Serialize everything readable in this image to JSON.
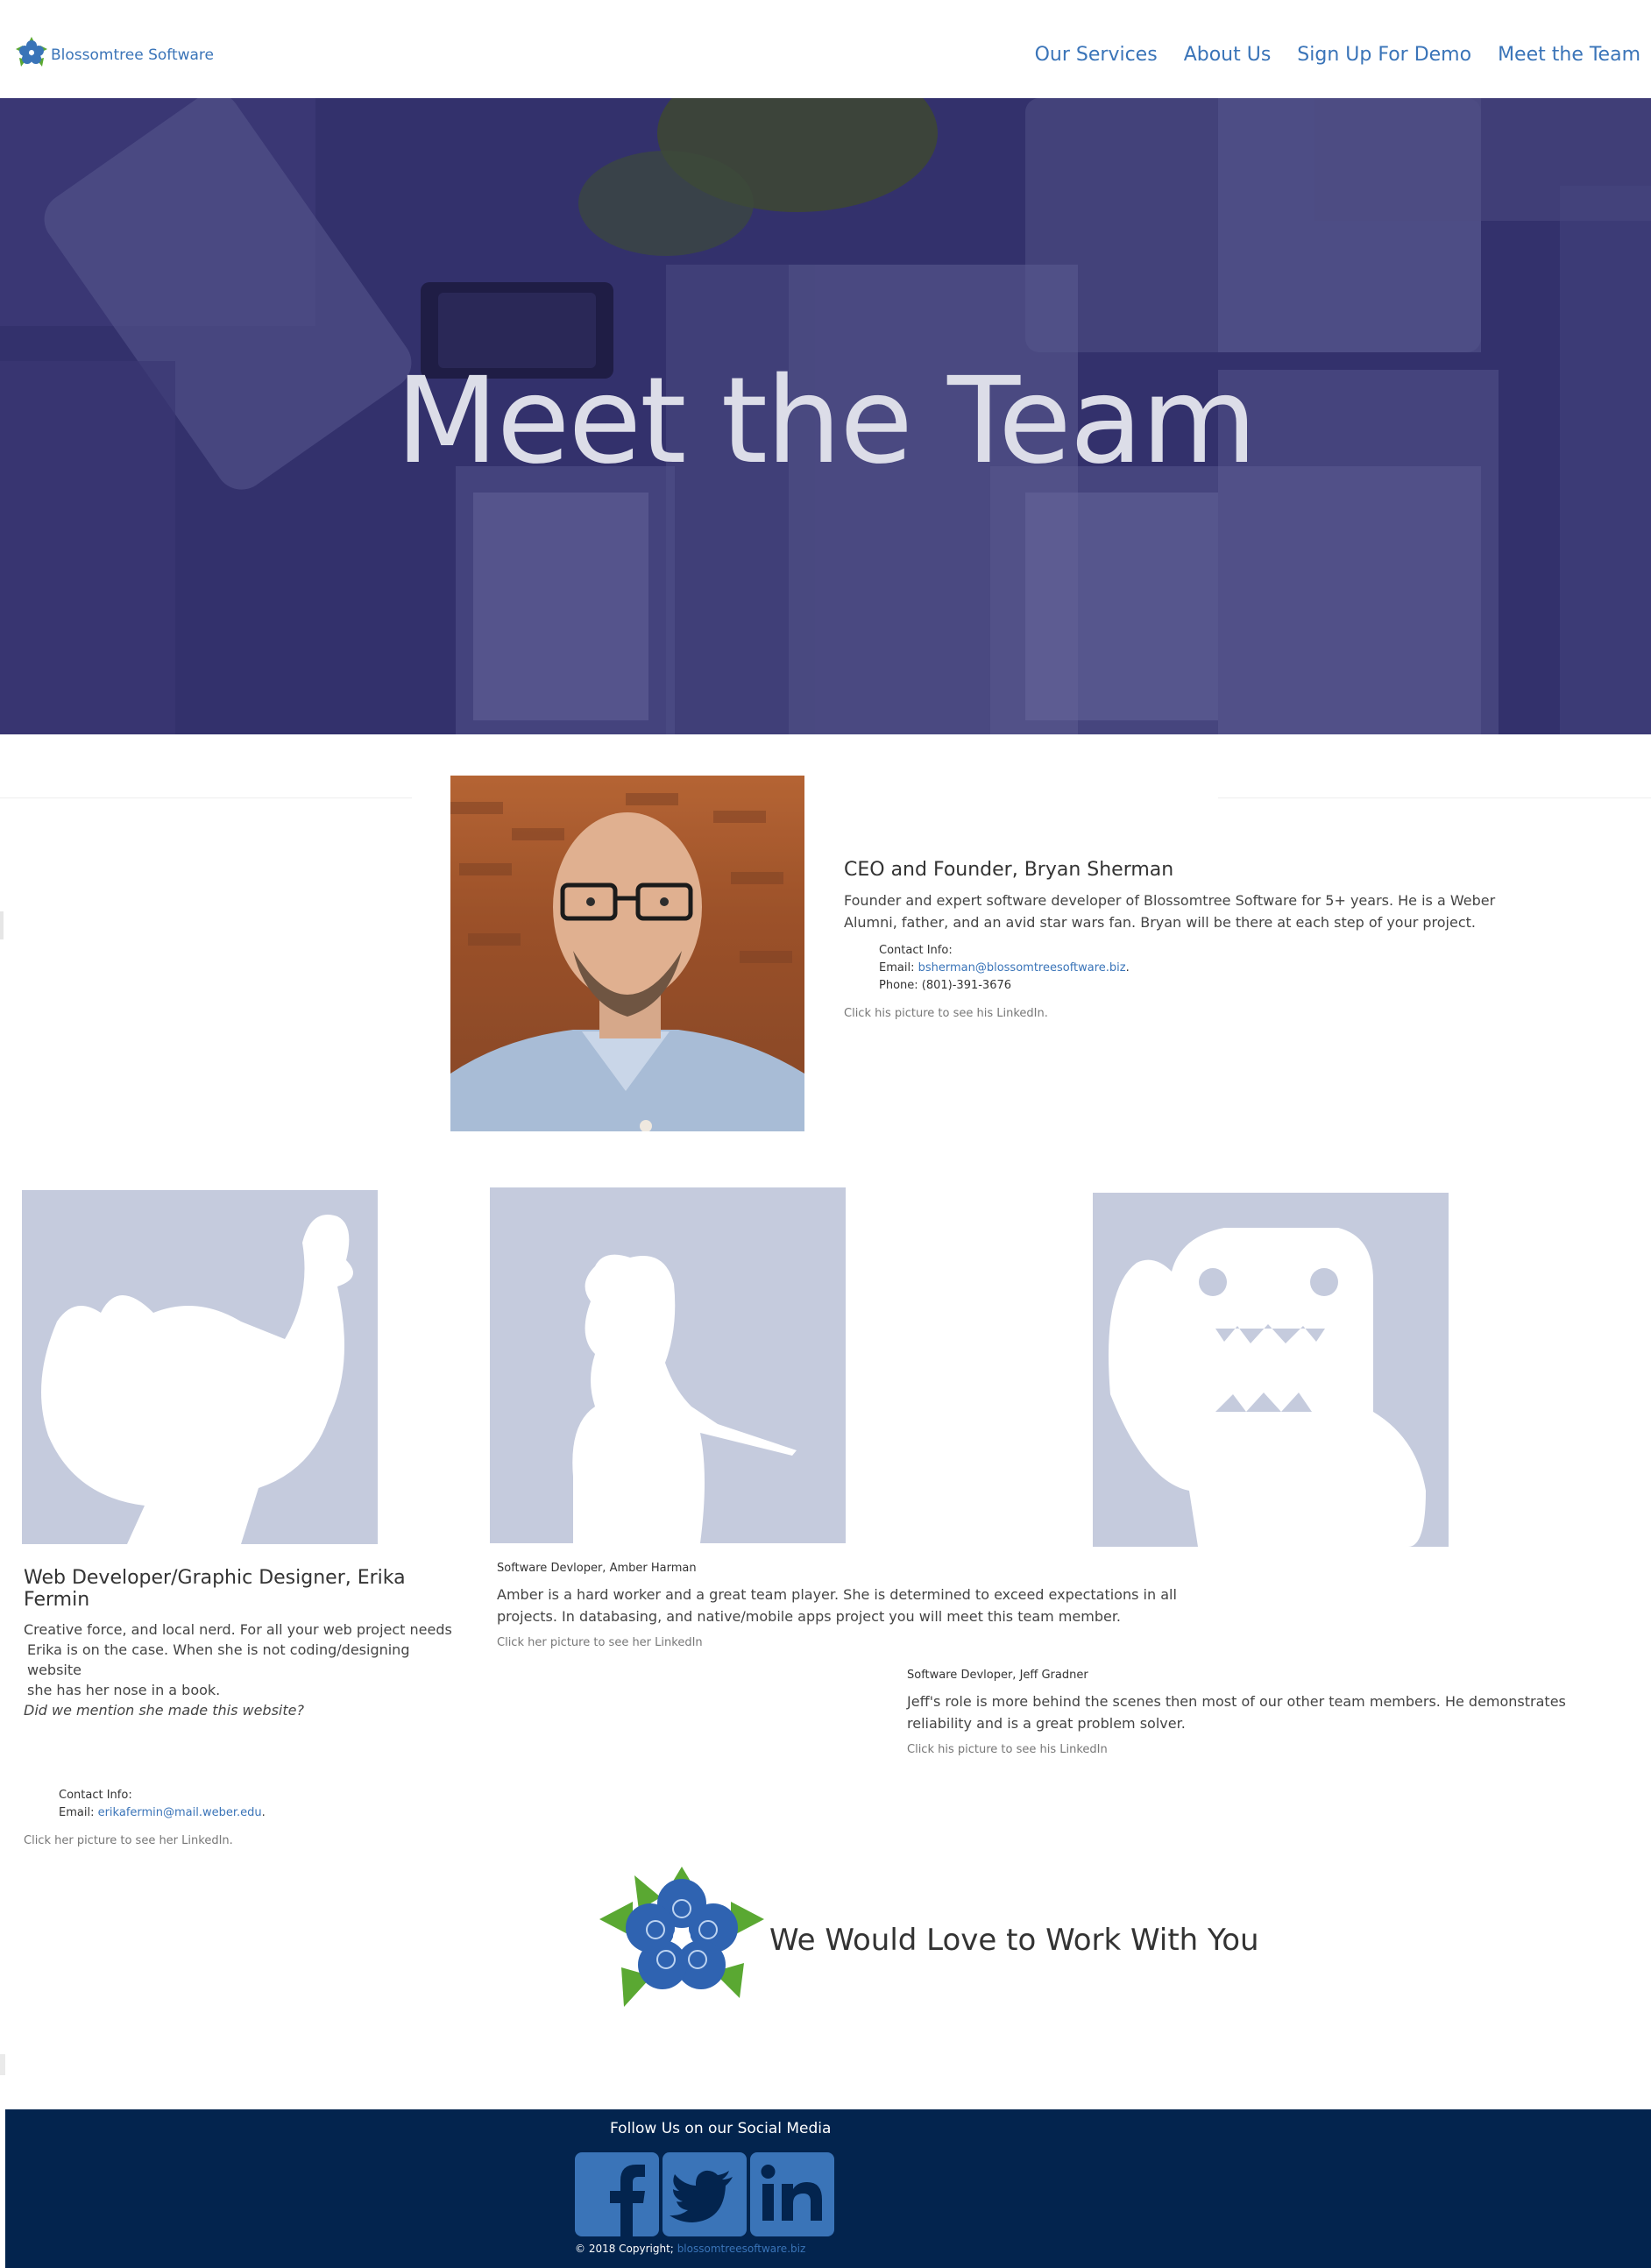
{
  "header": {
    "brand": "Blossomtree Software",
    "nav": [
      "Our Services",
      "About Us",
      "Sign Up For Demo",
      "Meet the Team"
    ]
  },
  "hero": {
    "title": "Meet the Team"
  },
  "ceo": {
    "title": "CEO and Founder, Bryan Sherman",
    "desc": "Founder and expert software developer of Blossomtree Software for 5+ years. He is a Weber Alumni, father, and an avid star wars fan. Bryan will be there at each step of your project.",
    "contact_label": "Contact Info:",
    "email_label": "Email:",
    "email": "bsherman@blossomtreesoftware.biz",
    "phone": "Phone: (801)-391-3676",
    "hint": "Click his picture to see his LinkedIn."
  },
  "erika": {
    "title": "Web Developer/Graphic Designer, Erika Fermin",
    "desc_line1": "Creative force, and local nerd. For all your web project needs",
    "desc_line2": "Erika is on the case. When she is not   coding/designing website",
    "desc_line3": "she has her nose in a book.",
    "desc_italic": "Did we mention she made this website?",
    "contact_label": "Contact Info:",
    "email_label": "Email:",
    "email": "erikafermin@mail.weber.edu",
    "hint": "Click her picture to see her LinkedIn."
  },
  "amber": {
    "title": "Software Devloper, Amber Harman",
    "desc": "Amber is a hard worker and a great team player. She is determined to exceed expectations in all projects. In databasing, and native/mobile apps project you will meet this team member.",
    "hint": "Click her picture to see her LinkedIn"
  },
  "jeff": {
    "title": "Software Devloper, Jeff Gradner",
    "desc": "Jeff's role is more behind the scenes then most of our other team members. He demonstrates reliability and is a great problem solver.",
    "hint": "Click his picture to see his LinkedIn"
  },
  "cta": {
    "text": "We Would Love to Work With You"
  },
  "footer": {
    "follow": "Follow Us on our Social Media",
    "copyright": "© 2018 Copyright;",
    "site": "blossomtreesoftware.biz"
  },
  "colors": {
    "brand_blue": "#3a74b8",
    "footer_navy": "#03244e",
    "hero_overlay": "#2e2c66",
    "silhouette_bg": "#c5cbdd"
  },
  "icons": [
    "blossom-logo-icon",
    "facebook-icon",
    "twitter-icon",
    "linkedin-icon"
  ]
}
